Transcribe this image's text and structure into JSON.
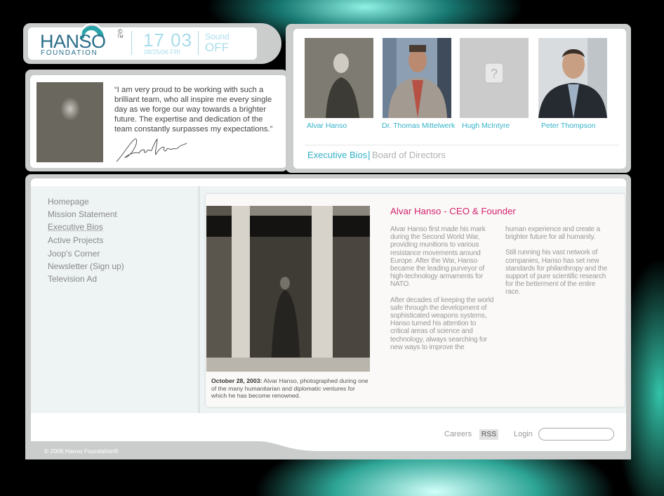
{
  "logo": {
    "name": "HANSO",
    "subtitle": "FOUNDATION",
    "copyright_mark": "©",
    "tm": "TM"
  },
  "clock": {
    "time": "17 03",
    "date": "08/25/06 FRI"
  },
  "sound": {
    "label": "Sound",
    "state": "OFF"
  },
  "quote": {
    "text": "“I am very proud to be working with such a brilliant team, who all inspire me every single day as we forge our way towards a brighter future. The expertise and dedication of the team constantly surpasses my expectations.”"
  },
  "bios": {
    "people": [
      {
        "name": "Alvar Hanso"
      },
      {
        "name": "Dr. Thomas Mittelwerk"
      },
      {
        "name": "Hugh McIntyre"
      },
      {
        "name": "Peter Thompson"
      }
    ],
    "tabs": {
      "exec": "Executive Bios",
      "separator": "|",
      "board": "Board of Directors"
    }
  },
  "nav": {
    "items": [
      {
        "label": "Homepage"
      },
      {
        "label": "Mission Statement"
      },
      {
        "label": "Executive Bios"
      },
      {
        "label": "Active Projects"
      },
      {
        "label": "Joop's Corner"
      },
      {
        "label": "Newsletter (Sign up)"
      },
      {
        "label": "Television Ad"
      }
    ]
  },
  "article": {
    "title": "Alvar Hanso - CEO & Founder",
    "caption_date": "October 28, 2003:",
    "caption_text": " Alvar Hanso, photographed during one of the many humanitarian and diplomatic ventures for which he has become renowned.",
    "col1_p1": "Alvar Hanso first made his mark during the Second World War, providing munitions to various resistance movements around Europe.  After the War, Hanso became the leading purveyor of high-technology armaments for NATO.",
    "col1_p2": "After decades of keeping the world safe through the development of sophisticated weapons systems, Hanso turned his attention to critical areas of science and technology, always searching for new ways to improve the",
    "col2_p1": "human experience and create a brighter future for all humanity.",
    "col2_p2": "Still running his vast network of companies, Hanso has set new standards for philanthropy and the support of pure scientific research for the betterment of the entire race."
  },
  "footer": {
    "careers": "Careers",
    "rss": "RSS",
    "login_label": "Login",
    "login_value": "",
    "copyright": "© 2006 Hanso Foundation®"
  },
  "colors": {
    "accent": "#34b2c8",
    "title": "#d4236e",
    "logo": "#2b6f8a"
  }
}
